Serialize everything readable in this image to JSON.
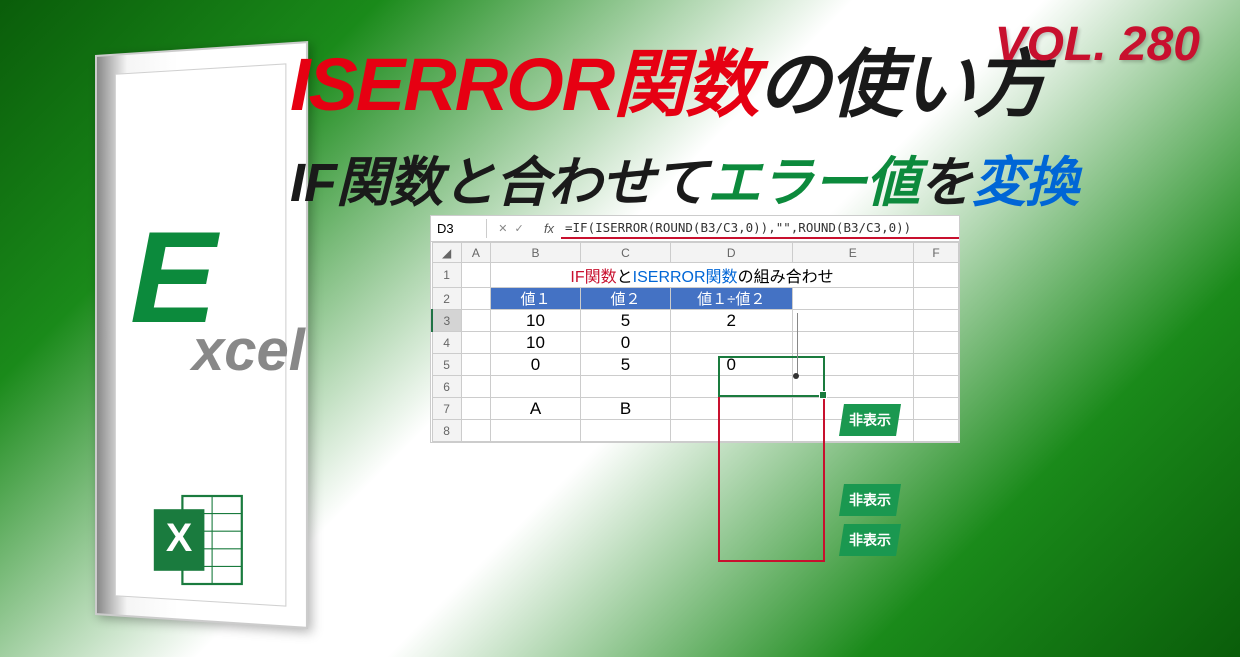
{
  "volume": "VOL. 280",
  "title1": {
    "red": "ISERROR関数",
    "black": "の使い方"
  },
  "title2": {
    "part1": "IF関数と合わせて",
    "part2": "エラー値",
    "part3": "を",
    "part4": "変換"
  },
  "excel_label": {
    "e": "E",
    "rest": "xcel"
  },
  "sheet": {
    "name_box": "D3",
    "formula": "=IF(ISERROR(ROUND(B3/C3,0)),\"\",ROUND(B3/C3,0))",
    "col_headers": [
      "A",
      "B",
      "C",
      "D",
      "E",
      "F"
    ],
    "row_headers": [
      "1",
      "2",
      "3",
      "4",
      "5",
      "6",
      "7",
      "8"
    ],
    "merged_title": {
      "red": "IF関数",
      "mid": "と",
      "blue": "ISERROR関数",
      "tail": "の組み合わせ"
    },
    "data_headers": [
      "値１",
      "値２",
      "値１÷値２"
    ],
    "rows": [
      {
        "v1": "10",
        "v2": "5",
        "res": "2"
      },
      {
        "v1": "10",
        "v2": "0",
        "res": ""
      },
      {
        "v1": "0",
        "v2": "5",
        "res": "0"
      },
      {
        "v1": "",
        "v2": "",
        "res": ""
      },
      {
        "v1": "A",
        "v2": "B",
        "res": ""
      }
    ],
    "badge_text": "非表示"
  }
}
